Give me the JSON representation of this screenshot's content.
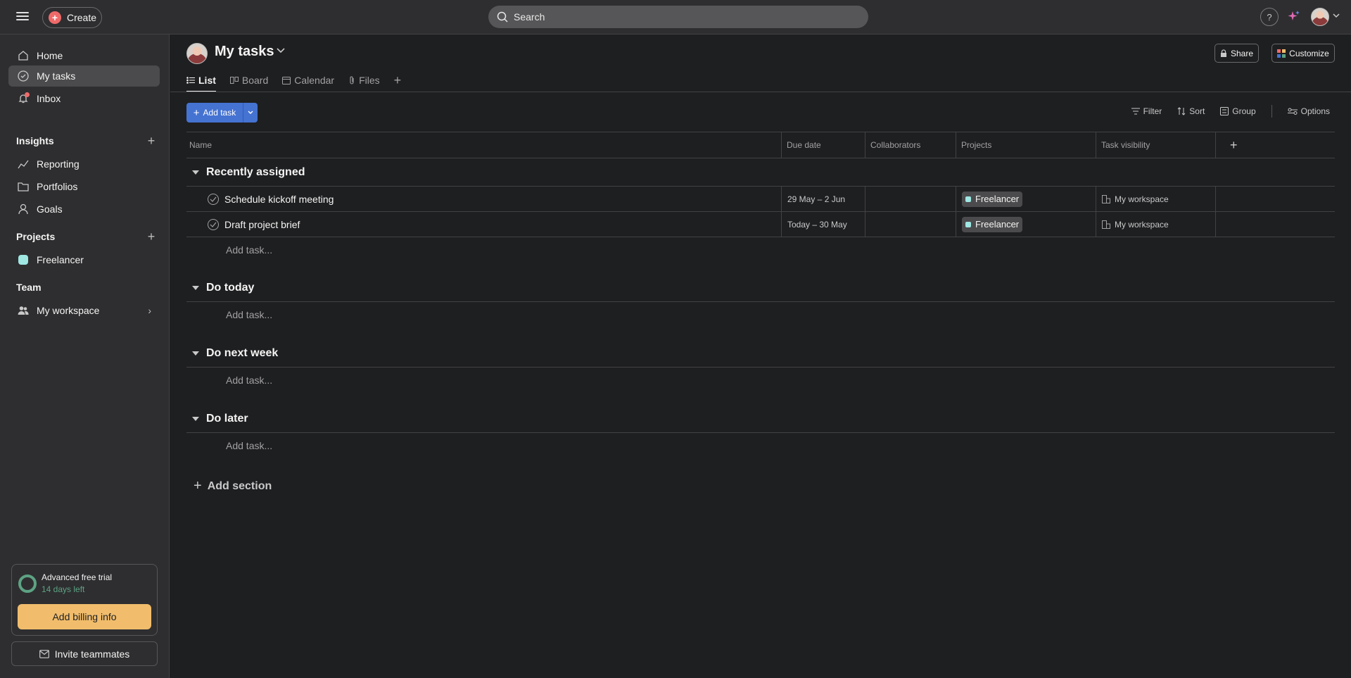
{
  "topbar": {
    "create_label": "Create",
    "search_placeholder": "Search",
    "help_label": "?"
  },
  "sidebar": {
    "nav": [
      {
        "label": "Home",
        "icon": "home-icon"
      },
      {
        "label": "My tasks",
        "icon": "check-circle-icon",
        "active": true
      },
      {
        "label": "Inbox",
        "icon": "bell-icon"
      }
    ],
    "insights_label": "Insights",
    "insights_items": [
      {
        "label": "Reporting",
        "icon": "chart-line-icon"
      },
      {
        "label": "Portfolios",
        "icon": "folder-icon"
      },
      {
        "label": "Goals",
        "icon": "person-icon"
      }
    ],
    "projects_label": "Projects",
    "projects": [
      {
        "label": "Freelancer",
        "color": "#9ee7e3"
      }
    ],
    "team_label": "Team",
    "team_items": [
      {
        "label": "My workspace",
        "icon": "people-icon"
      }
    ],
    "trial": {
      "title": "Advanced free trial",
      "days_left": "14 days left",
      "billing_label": "Add billing info"
    },
    "invite_label": "Invite teammates"
  },
  "main": {
    "title": "My tasks",
    "share_label": "Share",
    "customize_label": "Customize",
    "tabs": [
      {
        "label": "List",
        "active": true
      },
      {
        "label": "Board"
      },
      {
        "label": "Calendar"
      },
      {
        "label": "Files"
      }
    ],
    "add_task_label": "Add task",
    "toolbar": {
      "filter": "Filter",
      "sort": "Sort",
      "group": "Group",
      "options": "Options"
    },
    "columns": [
      "Name",
      "Due date",
      "Collaborators",
      "Projects",
      "Task visibility"
    ],
    "sections": [
      {
        "title": "Recently assigned",
        "tasks": [
          {
            "name": "Schedule kickoff meeting",
            "due": "29 May – 2 Jun",
            "project": "Freelancer",
            "visibility": "My workspace"
          },
          {
            "name": "Draft project brief",
            "due": "Today – 30 May",
            "project": "Freelancer",
            "visibility": "My workspace"
          }
        ],
        "add_task": "Add task..."
      },
      {
        "title": "Do today",
        "add_task": "Add task..."
      },
      {
        "title": "Do next week",
        "add_task": "Add task..."
      },
      {
        "title": "Do later",
        "add_task": "Add task..."
      }
    ],
    "add_section_label": "Add section"
  },
  "colors": {
    "accent_blue": "#4573d2",
    "create_red": "#f06a6a",
    "trial_green": "#5da283",
    "billing_yellow": "#f1bd6c",
    "project_teal": "#9ee7e3"
  }
}
